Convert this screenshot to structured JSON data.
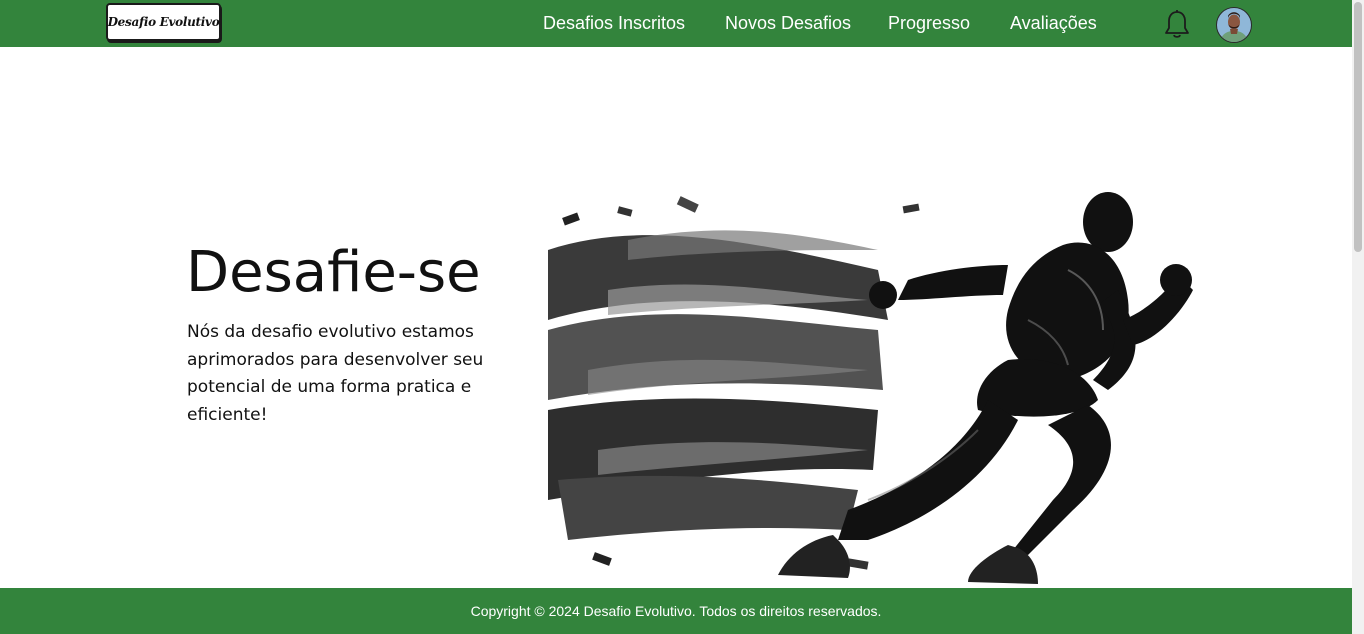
{
  "header": {
    "logo_text": "Desafio Evolutivo",
    "nav": [
      {
        "label": "Desafios Inscritos"
      },
      {
        "label": "Novos Desafios"
      },
      {
        "label": "Progresso"
      },
      {
        "label": "Avaliações"
      }
    ],
    "notification_icon": "bell-icon",
    "avatar_icon": "user-avatar"
  },
  "hero": {
    "title": "Desafie-se",
    "description": "Nós da desafio evolutivo estamos aprimorados para desenvolver seu potencial de uma forma pratica e eficiente!",
    "image": "running-athlete-illustration"
  },
  "footer": {
    "copyright": "Copyright © 2024 Desafio Evolutivo. Todos os direitos reservados."
  },
  "colors": {
    "primary_green": "#33843c",
    "text": "#111111",
    "background": "#ffffff"
  }
}
